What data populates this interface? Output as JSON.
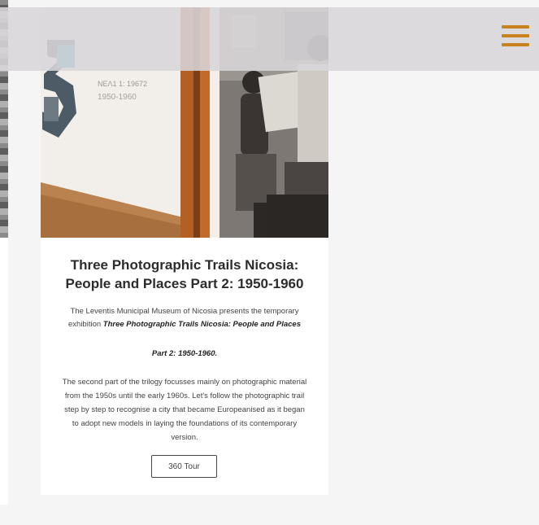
{
  "header": {
    "menu_icon": "hamburger-menu-icon",
    "accent_color": "#c8821e"
  },
  "card": {
    "image": {
      "wall_number": "3",
      "wall_caption_line1": "ΝΕΛ1 1: 19672",
      "wall_caption_line2": "1950-1960"
    },
    "title": "Three Photographic Trails Nicosia:\nPeople and Places Part 2: 1950-1960",
    "intro_prefix": "The Leventis Municipal Museum of Nicosia presents the temporary exhibition ",
    "intro_emphasis": "Three Photographic Trails Nicosia: People and Places",
    "dates": "Part 2: 1950-1960.",
    "body": "The second part of the trilogy focusses mainly on photographic material from the 1950s until the early 1960s. Let's follow the photographic trail step by step to recognise a city that became Europeanised as it began to adopt new models in laying the foundations of its contemporary version.",
    "button_label": "360 Tour"
  }
}
